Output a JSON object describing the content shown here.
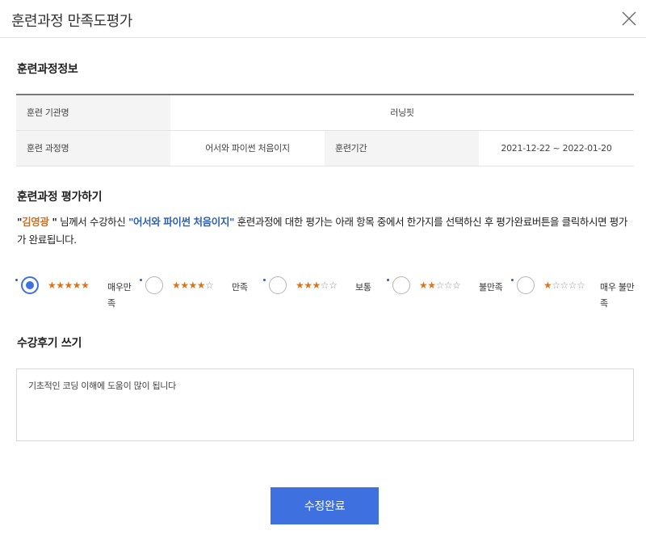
{
  "modal": {
    "title": "훈련과정 만족도평가"
  },
  "course_info": {
    "section_title": "훈련과정정보",
    "institution_label": "훈련 기관명",
    "institution_value": "러닝핏",
    "course_label": "훈련 과정명",
    "course_value": "어서와 파이썬 처음이지",
    "period_label": "훈련기간",
    "period_value": "2021-12-22 ~ 2022-01-20"
  },
  "evaluation": {
    "section_title": "훈련과정 평가하기",
    "quote_open": "\"",
    "user_name": "김영광",
    "quote_after_name": " \"",
    "text_1": " 님께서 수강하신 ",
    "course_name": "\"어서와 파이썬 처음이지\"",
    "text_2": " 훈련과정에 대한 평가는 아래 항목 중에서 한가지를 선택하신 후 평가완료버튼을 클릭하시면 평가가 완료됩니다."
  },
  "ratings": [
    {
      "label": "매우만족",
      "stars": 5,
      "selected": true
    },
    {
      "label": "만족",
      "stars": 4,
      "selected": false
    },
    {
      "label": "보통",
      "stars": 3,
      "selected": false
    },
    {
      "label": "불만족",
      "stars": 2,
      "selected": false
    },
    {
      "label": "매우 불만족",
      "stars": 1,
      "selected": false
    }
  ],
  "review": {
    "section_title": "수강후기 쓰기",
    "text": "기초적인 코딩 이해에 도움이 많이 됩니다"
  },
  "actions": {
    "submit_label": "수정완료"
  },
  "colors": {
    "accent": "#3e70e0",
    "star": "#d6761f",
    "name_highlight": "#c5722b",
    "course_highlight": "#2e5fb2"
  }
}
